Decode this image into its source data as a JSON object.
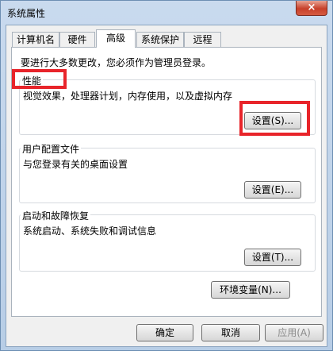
{
  "window": {
    "title": "系统属性",
    "close_icon": "×"
  },
  "tabs": [
    {
      "label": "计算机名"
    },
    {
      "label": "硬件"
    },
    {
      "label": "高级"
    },
    {
      "label": "系统保护"
    },
    {
      "label": "远程"
    }
  ],
  "notice": "要进行大多数更改，您必须作为管理员登录。",
  "performance": {
    "label": "性能",
    "desc": "视觉效果，处理器计划，内存使用，以及虚拟内存",
    "button": "设置(S)..."
  },
  "profile": {
    "label": "用户配置文件",
    "desc": "与您登录有关的桌面设置",
    "button": "设置(E)..."
  },
  "startup": {
    "label": "启动和故障恢复",
    "desc": "系统启动、系统失败和调试信息",
    "button": "设置(T)..."
  },
  "env_button": "环境变量(N)...",
  "footer": {
    "ok": "确定",
    "cancel": "取消",
    "apply": "应用(A)"
  },
  "colors": {
    "highlight": "#e8242a"
  }
}
